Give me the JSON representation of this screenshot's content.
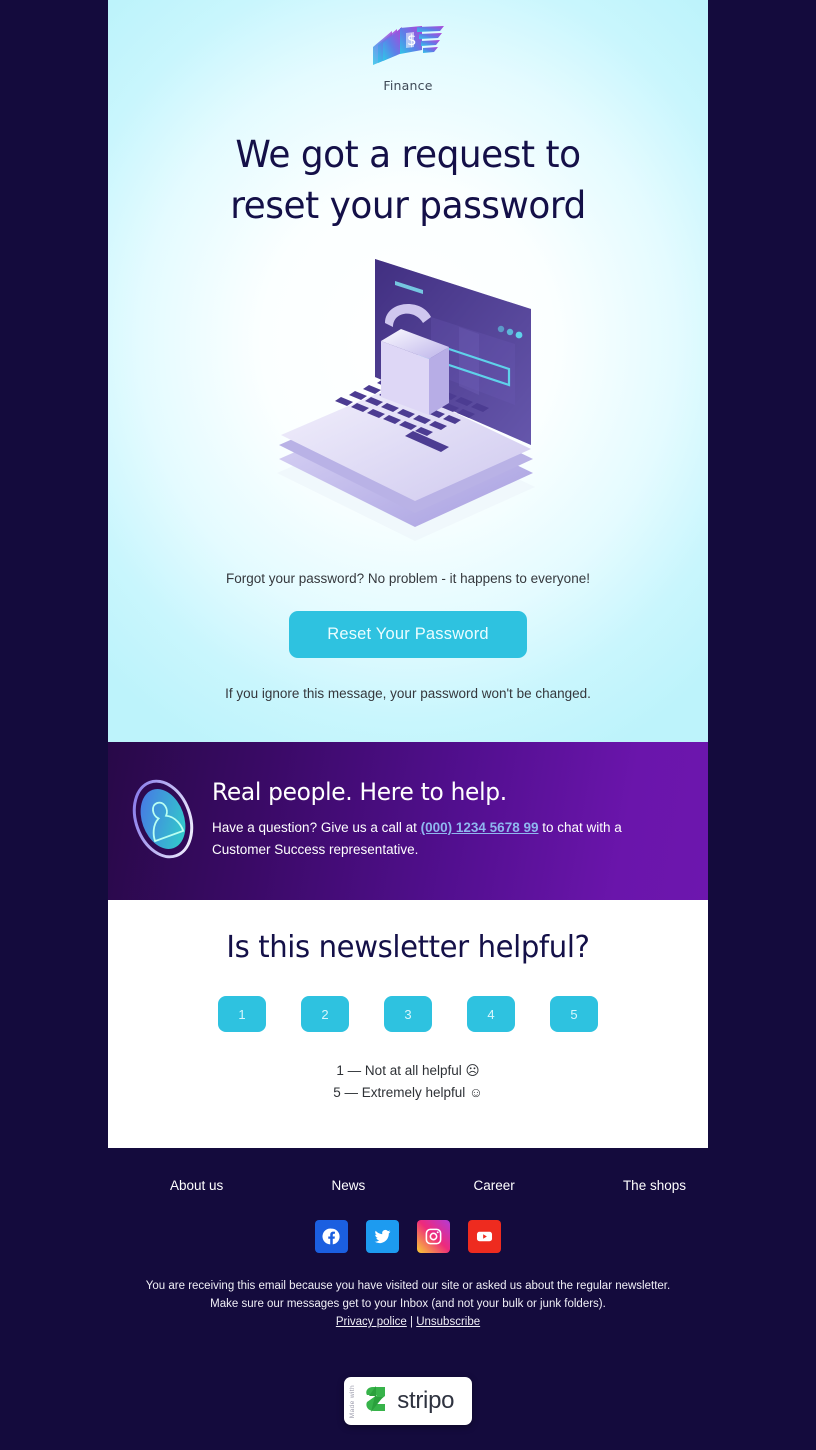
{
  "brand": {
    "logo_icon": "money-stack-icon",
    "logo_label": "Finance",
    "accent_cyan": "#2ec2e0",
    "dark_navy": "#140b3d",
    "heading_color": "#141048",
    "purple_start": "#280948",
    "purple_end": "#6d16ae"
  },
  "hero": {
    "headline_line1": "We got a request to",
    "headline_line2": "reset your password",
    "illustration_icon": "laptop-padlock-icon",
    "intro_text": "Forgot your password? No problem - it happens to everyone!",
    "cta_label": "Reset Your Password",
    "footnote": "If you ignore this message, your password won't be changed."
  },
  "help": {
    "icon": "person-ellipse-icon",
    "title": "Real people. Here to help.",
    "body_before": "Have a question? Give us a call at ",
    "phone": "(000) 1234 5678 99",
    "body_after": " to chat with a Customer Success representative."
  },
  "rating": {
    "title": "Is this newsletter helpful?",
    "options": [
      "1",
      "2",
      "3",
      "4",
      "5"
    ],
    "legend_low": "1 — Not at all helpful ☹",
    "legend_high": "5 — Extremely helpful ☺"
  },
  "footer": {
    "nav": [
      {
        "label": "About us"
      },
      {
        "label": "News"
      },
      {
        "label": "Career"
      },
      {
        "label": "The shops"
      }
    ],
    "social": [
      {
        "name": "facebook-icon",
        "color": "#1b5fe0"
      },
      {
        "name": "twitter-icon",
        "color": "#1d9bf0"
      },
      {
        "name": "instagram-icon",
        "color": "#d62976"
      },
      {
        "name": "youtube-icon",
        "color": "#ee2b1f"
      }
    ],
    "legal_line1": "You are receiving this email because you have visited our site or asked us about the regular newsletter.",
    "legal_line2": "Make sure our messages get to your Inbox (and not your bulk or junk folders).",
    "privacy_label": "Privacy police",
    "legal_separator": " | ",
    "unsubscribe_label": "Unsubscribe"
  },
  "badge": {
    "made_with": "Made with",
    "name": "stripo",
    "logo_icon": "stripo-logo-icon"
  }
}
